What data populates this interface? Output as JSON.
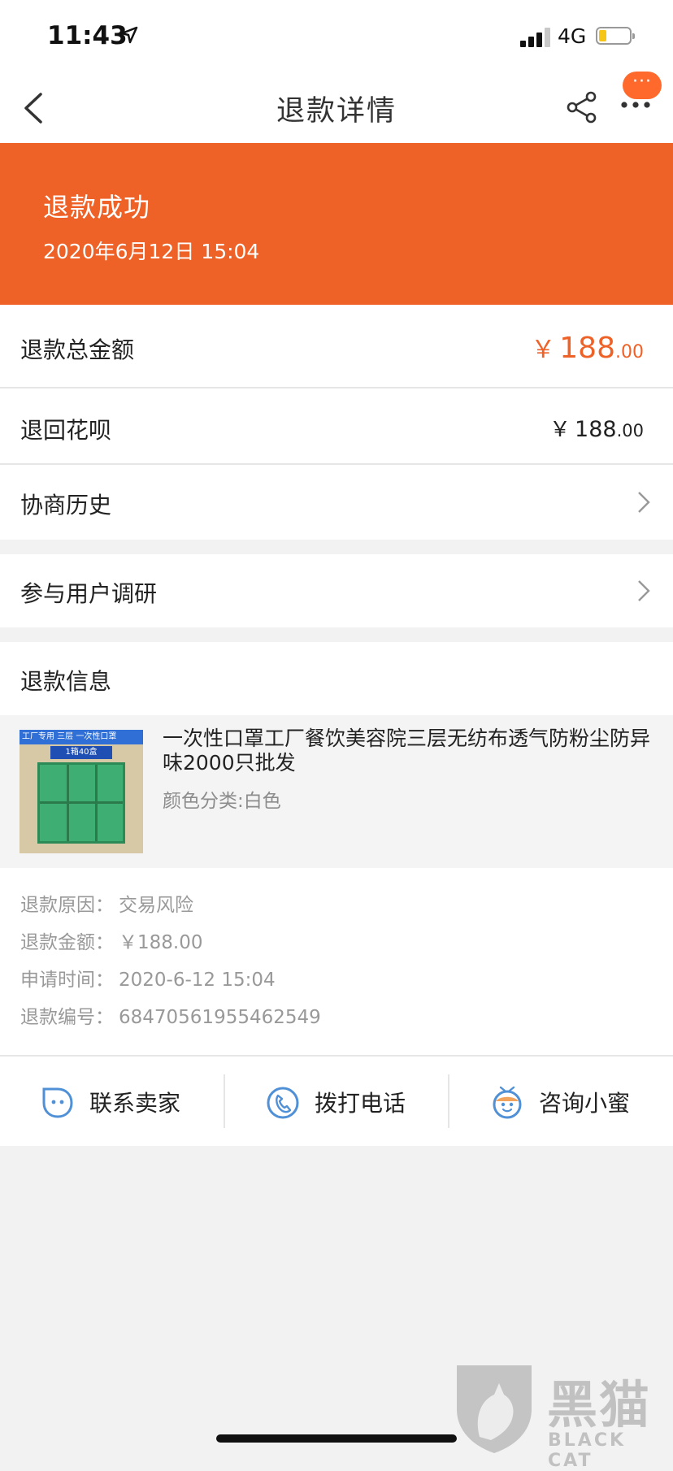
{
  "status_bar": {
    "time": "11:43",
    "network": "4G",
    "battery_level": 0.15
  },
  "nav": {
    "title": "退款详情",
    "bubble": "···",
    "icons": [
      "back-icon",
      "share-icon",
      "more-icon"
    ]
  },
  "banner": {
    "title": "退款成功",
    "datetime": "2020年6月12日 15:04",
    "color": "#ee6127"
  },
  "rows": {
    "total": {
      "label": "退款总金额",
      "currency": "￥",
      "int": "188",
      "dec": ".00",
      "color": "#ee6127"
    },
    "huabei": {
      "label": "退回花呗",
      "currency": "￥",
      "int": "188",
      "dec": ".00"
    },
    "history": {
      "label": "协商历史"
    },
    "survey": {
      "label": "参与用户调研"
    },
    "refund_info": {
      "label": "退款信息"
    }
  },
  "product": {
    "thumb_banner": "工厂专用  三层 一次性口罩",
    "thumb_badge": "1箱40盒",
    "name": "一次性口罩工厂餐饮美容院三层无纺布透气防粉尘防异味2000只批发",
    "sku": "颜色分类:白色"
  },
  "refund_details": [
    {
      "key": "退款原因：",
      "value": "交易风险"
    },
    {
      "key": "退款金额：",
      "value": "￥188.00"
    },
    {
      "key": "申请时间：",
      "value": "2020-6-12 15:04"
    },
    {
      "key": "退款编号：",
      "value": "68470561955462549"
    }
  ],
  "actions": [
    {
      "label": "联系卖家",
      "icon": "chat-face-icon"
    },
    {
      "label": "拨打电话",
      "icon": "phone-icon"
    },
    {
      "label": "咨询小蜜",
      "icon": "assistant-icon"
    }
  ],
  "watermark": {
    "text": "黑猫",
    "sub": "BLACK CAT"
  }
}
